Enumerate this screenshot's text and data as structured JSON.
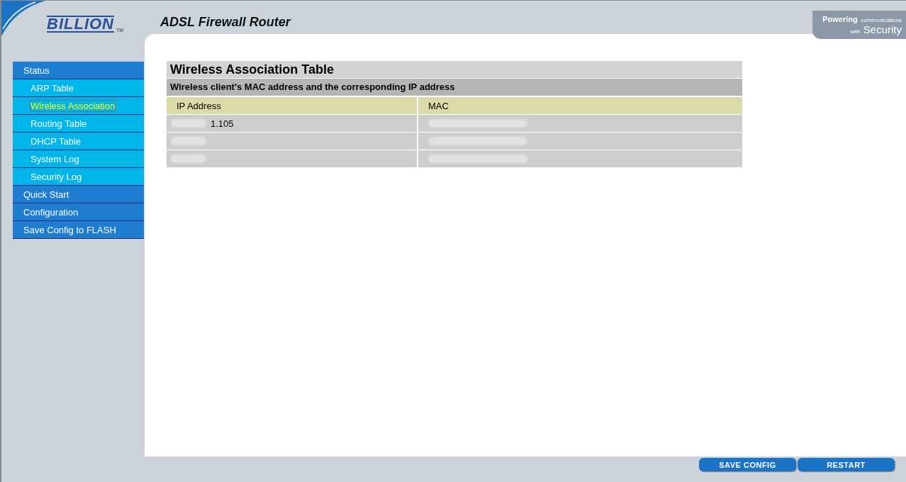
{
  "header": {
    "brand": "BILLION",
    "trademark": "TM",
    "title": "ADSL Firewall Router",
    "tagline_bold": "Powering",
    "tagline_small": "communications",
    "tagline_with": "with",
    "tagline_big": "Security"
  },
  "menu": [
    {
      "label": "Status",
      "kind": "section",
      "selected": false
    },
    {
      "label": "ARP Table",
      "kind": "sub",
      "selected": false
    },
    {
      "label": "Wireless Association",
      "kind": "sub",
      "selected": true
    },
    {
      "label": "Routing Table",
      "kind": "sub",
      "selected": false
    },
    {
      "label": "DHCP Table",
      "kind": "sub",
      "selected": false
    },
    {
      "label": "System Log",
      "kind": "sub",
      "selected": false
    },
    {
      "label": "Security Log",
      "kind": "sub",
      "selected": false
    },
    {
      "label": "Quick Start",
      "kind": "section",
      "selected": false
    },
    {
      "label": "Configuration",
      "kind": "section",
      "selected": false
    },
    {
      "label": "Save Config to FLASH",
      "kind": "section",
      "selected": false
    }
  ],
  "table": {
    "title": "Wireless Association Table",
    "subtitle": "Wireless client's MAC address and the corresponding IP address",
    "columns": [
      "IP Address",
      "MAC"
    ],
    "rows": [
      {
        "kind": "blurred",
        "ip_address": "1.105"
      },
      {
        "kind": "blurred"
      },
      {
        "kind": "blurred"
      }
    ]
  },
  "buttons": [
    "SAVE CONFIG",
    "RESTART"
  ]
}
